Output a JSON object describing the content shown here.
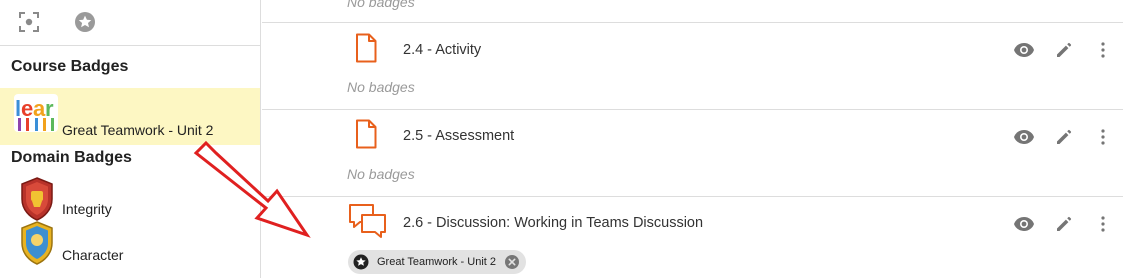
{
  "sidebar": {
    "toolbar": {
      "icons": [
        "focus-icon",
        "star-icon"
      ]
    },
    "course_heading": "Course Badges",
    "course_badges": [
      {
        "label": "Great Teamwork - Unit 2",
        "icon": "learn-badge-image",
        "selected": true
      }
    ],
    "domain_heading": "Domain Badges",
    "domain_badges": [
      {
        "label": "Integrity",
        "icon": "shield-badge-image"
      },
      {
        "label": "Character",
        "icon": "shield-badge-image"
      }
    ]
  },
  "main": {
    "top_row": {
      "no_badges": "No badges"
    },
    "rows": [
      {
        "title": "2.4 - Activity",
        "icon": "document-icon",
        "no_badges": "No badges"
      },
      {
        "title": "2.5 - Assessment",
        "icon": "document-icon",
        "no_badges": "No badges"
      },
      {
        "title": "2.6 - Discussion: Working in Teams Discussion",
        "icon": "discussion-icon",
        "badge_chip": {
          "label": "Great Teamwork - Unit 2",
          "icon": "star-icon"
        }
      }
    ],
    "action_icons": [
      "eye-icon",
      "pencil-icon",
      "more-vert-icon"
    ]
  },
  "colors": {
    "accent": "#e8601c",
    "selected_bg": "#fdf7c3",
    "annotation_arrow": "#e02020",
    "icon_gray": "#757575"
  }
}
